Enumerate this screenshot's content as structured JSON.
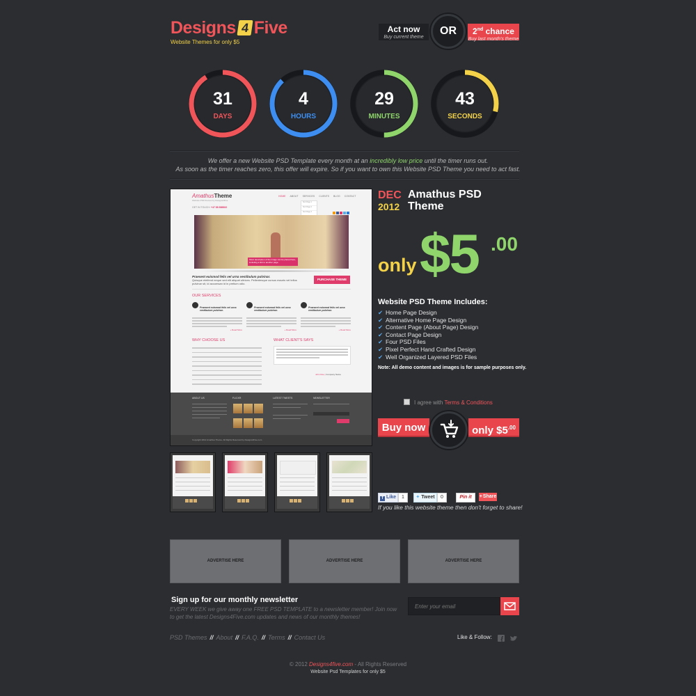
{
  "header": {
    "logo_left": "Designs",
    "logo_four": "4",
    "logo_right": "Five",
    "tagline": "Website Themes for only $5",
    "act_now": "Act now",
    "act_now_sub": "Buy current theme",
    "or": "OR",
    "second_num": "2",
    "second_sup": "nd",
    "second_chance": " chance",
    "second_sub": "Buy last month's theme"
  },
  "timer": [
    {
      "value": "31",
      "unit": "DAYS",
      "color": "#f0555a",
      "progress": 0.91
    },
    {
      "value": "4",
      "unit": "HOURS",
      "color": "#3d8ef0",
      "progress": 0.88
    },
    {
      "value": "29",
      "unit": "MINUTES",
      "color": "#8fd56c",
      "progress": 0.5
    },
    {
      "value": "43",
      "unit": "SECONDS",
      "color": "#f3d24a",
      "progress": 0.29
    }
  ],
  "intro": {
    "line1_a": "We offer a new Website PSD Template every month at an ",
    "line1_hl": "incredibly low price",
    "line1_b": " until the timer runs out.",
    "line2": "As soon as the timer reaches zero, this offer will expire. So if you want to own this Website PSD Theme you need to act fast."
  },
  "preview": {
    "title_a": "Amathus",
    "title_b": "Theme",
    "subtitle": "Website PSD themes by Designs4Five",
    "nav": [
      "HOME",
      "ABOUT",
      "SERVICES",
      "CLIENTS",
      "BLOG",
      "CONTACT"
    ],
    "dropdown": [
      "Sub Page 1",
      "Sub Page 2",
      "Sub Page 3",
      "Sub Page 4",
      "Sub Page 5"
    ],
    "touch_label": "GET IN TOUCH:",
    "touch_phone": "+47 88 888832",
    "hero_caption": "Short description of the image can be placed here, including a link to another page.",
    "purchase_title": "Praesent euismod felis vel urna vestibulum pulvinar.",
    "purchase_text": "Quisque eleifend neque sed elit aliquet ultrices. Pellentesque cursus mauris vel tellus pulvinar sit, id accumsan id in pretium odio.",
    "purchase_button": "PURCHASE THEME",
    "services_heading": "OUR SERVICES",
    "service_title": "Praesent euismod felis vel urna vestibulum pulvinar.",
    "read_more": "+ Read More",
    "why_heading": "WHY CHOOSE US",
    "clients_heading": "WHAT CLIENT'S SAYS",
    "quote_author": "John Doe",
    "quote_company": "Company Name",
    "footer_headings": [
      "ABOUT US",
      "FLICKR",
      "LATEST TWEETS",
      "NEWSLETTER"
    ],
    "copyright": "Copyright 2012 Amathus Theme. All Rights Reserved by Designs4Five.com"
  },
  "product": {
    "month": "DEC",
    "year": "2012",
    "title": "Amathus PSD Theme",
    "only": "only",
    "price": "$5",
    "cents": ".00",
    "includes_heading": "Website PSD Theme Includes:",
    "includes": [
      "Home Page Design",
      "Alternative Home Page Design",
      "Content Page (About Page) Design",
      "Contact Page Design",
      "Four PSD Files",
      "Pixel Perfect Hand Crafted Design",
      "Well Organized Layered PSD Files"
    ],
    "note": "Note: All demo content and images is for sample purposes only.",
    "agree_text": "I agree with ",
    "agree_link": "Terms & Conditions",
    "buy_now": "Buy now",
    "buy_price": "only $5",
    "buy_cents": ".00"
  },
  "share": {
    "fb_label": "Like",
    "fb_count": "1",
    "tw_label": "Tweet",
    "tw_count": "0",
    "pin_label": "Pin it",
    "share_label": "Share",
    "message": "If you like this website theme then don't forget to share!"
  },
  "ads": [
    "ADVERTISE HERE",
    "ADVERTISE HERE",
    "ADVERTISE HERE"
  ],
  "newsletter": {
    "heading": "Sign up for our monthly newsletter",
    "text": "EVERY WEEK we give away one FREE PSD TEMPLATE to a newsletter member! Join now to get the latest Designs4Five.com updates and news of our monthly themes!",
    "placeholder": "Enter your email"
  },
  "footer": {
    "links": [
      "PSD Themes",
      "About",
      "F.A.Q.",
      "Terms",
      "Contact Us"
    ],
    "separator": "//",
    "like_follow": "Like & Follow:",
    "copy_a": "© 2012 ",
    "copy_link": "Designs4five.com",
    "copy_b": " - All Rights Reserved",
    "copy2": "Website Psd Templates for only $5"
  }
}
